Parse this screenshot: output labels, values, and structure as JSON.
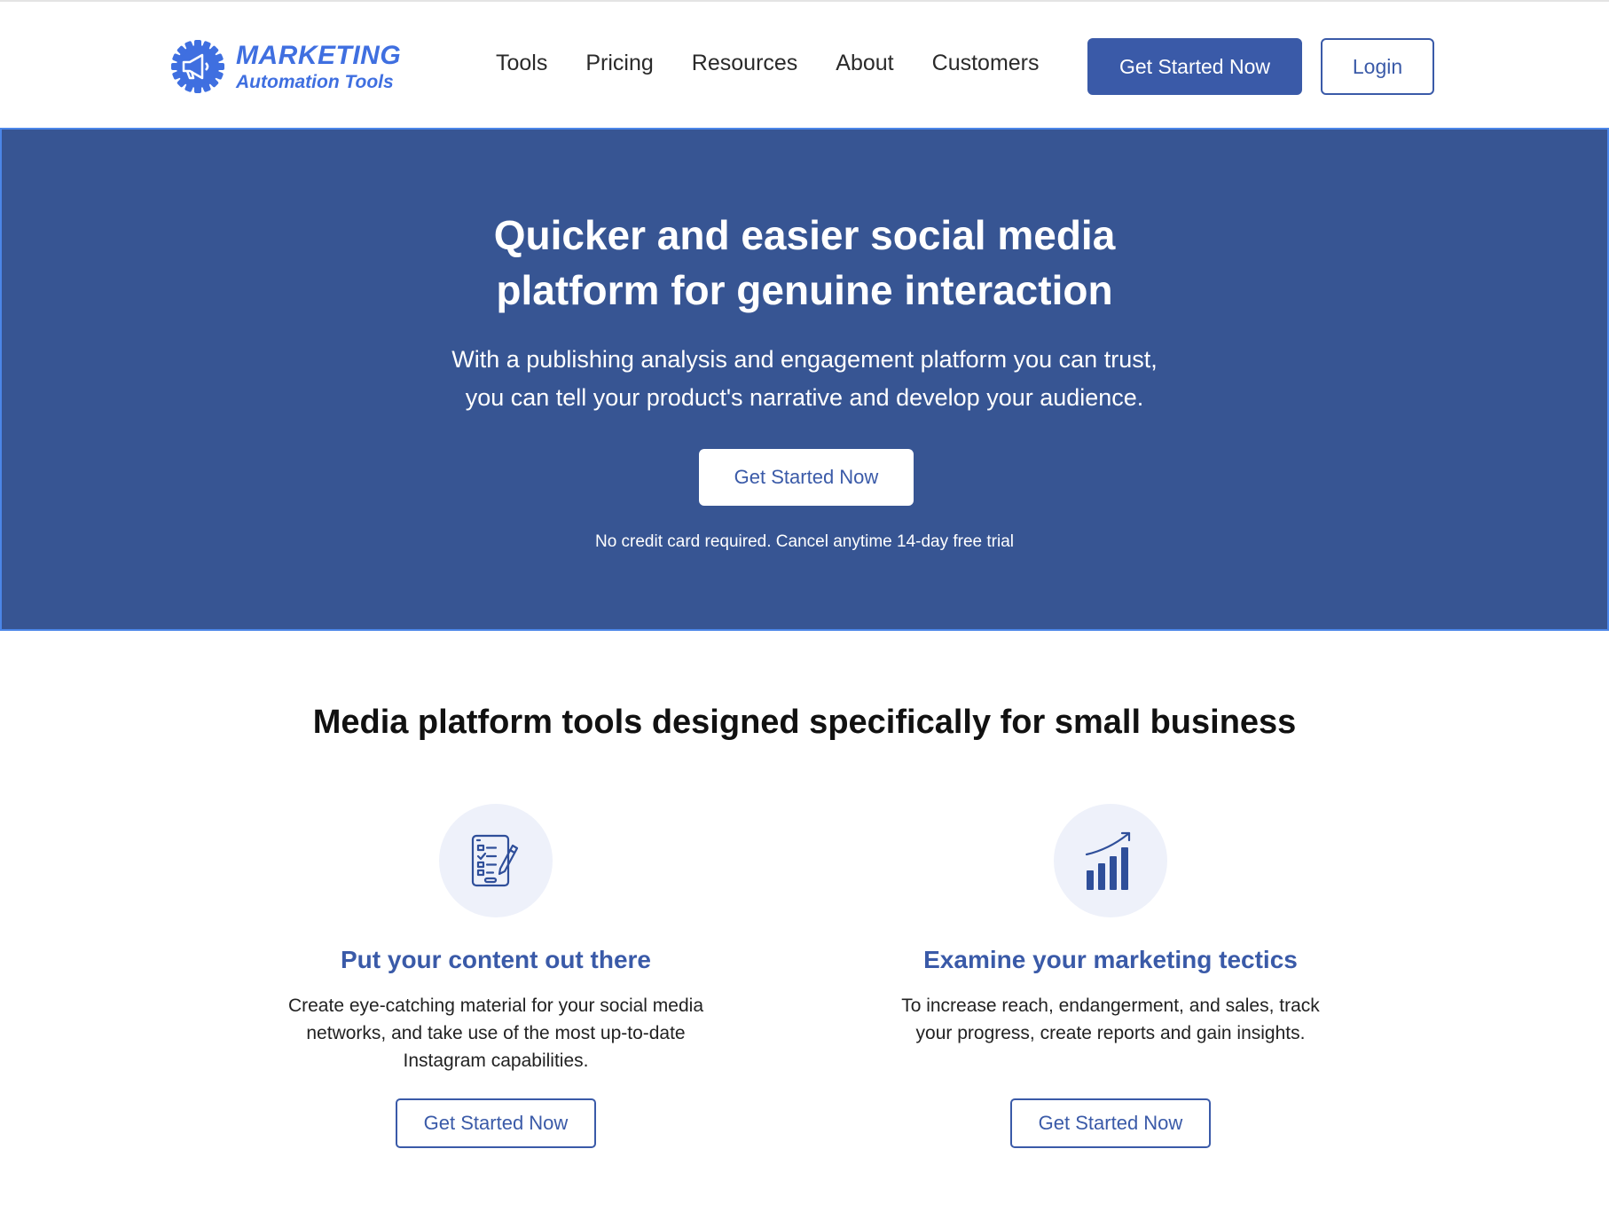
{
  "brand": {
    "name_line1": "MARKETING",
    "name_line2": "Automation Tools",
    "logo_icon": "megaphone-gear-icon",
    "color": "#3f6fe0"
  },
  "nav": {
    "items": [
      "Tools",
      "Pricing",
      "Resources",
      "About",
      "Customers"
    ],
    "cta_label": "Get Started Now",
    "login_label": "Login"
  },
  "hero": {
    "title_line1": "Quicker and easier social media",
    "title_line2": "platform for genuine interaction",
    "subtitle_line1": "With a publishing analysis and engagement platform you can trust,",
    "subtitle_line2": "you can tell your product's narrative and develop your audience.",
    "cta_label": "Get Started Now",
    "note": "No credit card required. Cancel anytime 14-day free trial",
    "background": "#375593"
  },
  "features": {
    "title": "Media platform tools designed specifically for small business",
    "items": [
      {
        "icon": "checklist-pencil-icon",
        "heading": "Put your content out there",
        "text_line1": "Create eye-catching material for your social media",
        "text_line2": "networks, and take use of the most up-to-date",
        "text_line3": "Instagram capabilities.",
        "cta_label": "Get Started Now"
      },
      {
        "icon": "growth-bar-chart-icon",
        "heading": "Examine your marketing tectics",
        "text_line1": "To increase reach, endangerment, and sales, track",
        "text_line2": "your progress, create reports and gain insights.",
        "cta_label": "Get Started Now"
      }
    ]
  },
  "colors": {
    "accent": "#3a5aa8",
    "icon_bg": "#eef1fa"
  }
}
